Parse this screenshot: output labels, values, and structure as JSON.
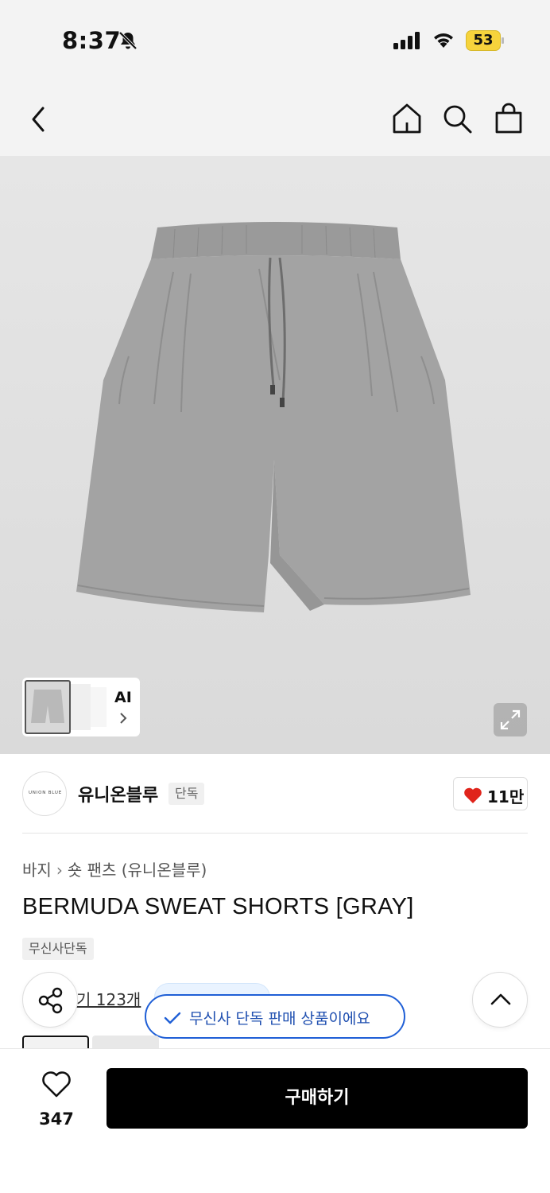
{
  "status_bar": {
    "time": "8:37",
    "battery": "53",
    "icons": [
      "bell-slash-icon",
      "cellular-signal-icon",
      "wifi-icon",
      "battery-icon"
    ]
  },
  "nav": {
    "icons": [
      "chevron-left-icon",
      "home-icon",
      "search-icon",
      "shopping-bag-icon"
    ]
  },
  "gallery": {
    "ai_label": "AI"
  },
  "brand": {
    "logo_text": "UNION BLUE",
    "name": "유니온블루",
    "badge": "단독",
    "like_count": "11만"
  },
  "product": {
    "breadcrumb": [
      "바지",
      "숏 팬츠 (유니온블루)"
    ],
    "title": "BERMUDA SWEAT SHORTS [GRAY]",
    "tag": "무신사단독",
    "review_text": "기 123개"
  },
  "toast": {
    "text": "무신사 단독 판매 상품이에요"
  },
  "bottom": {
    "wish_count": "347",
    "buy_label": "구매하기"
  },
  "colors": {
    "toast_border": "#1f5fd6",
    "buy_button": "#000000",
    "heart": "#e0241b",
    "battery": "#f6d33c"
  }
}
